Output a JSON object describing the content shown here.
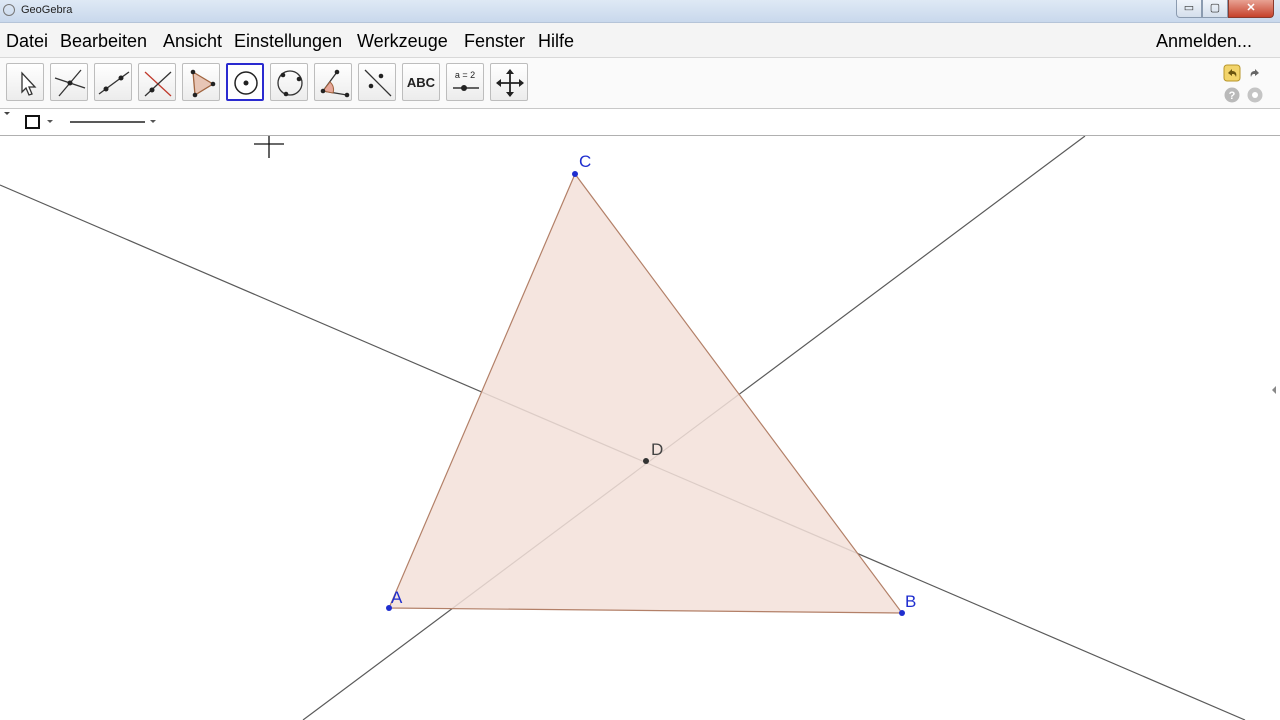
{
  "window": {
    "title": "GeoGebra",
    "min_glyph": "▭",
    "max_glyph": "▢",
    "close_glyph": "✕"
  },
  "menu": {
    "items": [
      "Datei",
      "Bearbeiten",
      "Ansicht",
      "Einstellungen",
      "Werkzeuge",
      "Fenster",
      "Hilfe"
    ],
    "login": "Anmelden..."
  },
  "toolbar": {
    "tools": [
      {
        "icon": "move-arrow-icon"
      },
      {
        "icon": "point-on-lines-icon"
      },
      {
        "icon": "line-through-points-icon"
      },
      {
        "icon": "perpendicular-line-icon"
      },
      {
        "icon": "polygon-icon"
      },
      {
        "icon": "circle-center-point-icon",
        "selected": true
      },
      {
        "icon": "circle-three-points-icon"
      },
      {
        "icon": "angle-icon"
      },
      {
        "icon": "reflect-line-icon"
      },
      {
        "icon": "text-icon",
        "label": "ABC"
      },
      {
        "icon": "slider-icon",
        "label": "a = 2"
      },
      {
        "icon": "move-graphics-view-icon"
      }
    ],
    "undo_icon": "undo-icon",
    "redo_icon": "redo-icon",
    "help_icon": "help-icon",
    "settings_icon": "settings-icon"
  },
  "colors": {
    "point": "#1f2ecf",
    "triangle_fill": "#f3e1d9",
    "triangle_stroke": "#b38068",
    "line": "#5a5a5a"
  },
  "construction": {
    "points": [
      {
        "name": "A"
      },
      {
        "name": "B"
      },
      {
        "name": "C"
      },
      {
        "name": "D"
      }
    ],
    "polygon": [
      "A",
      "B",
      "C"
    ],
    "lines": 2
  }
}
